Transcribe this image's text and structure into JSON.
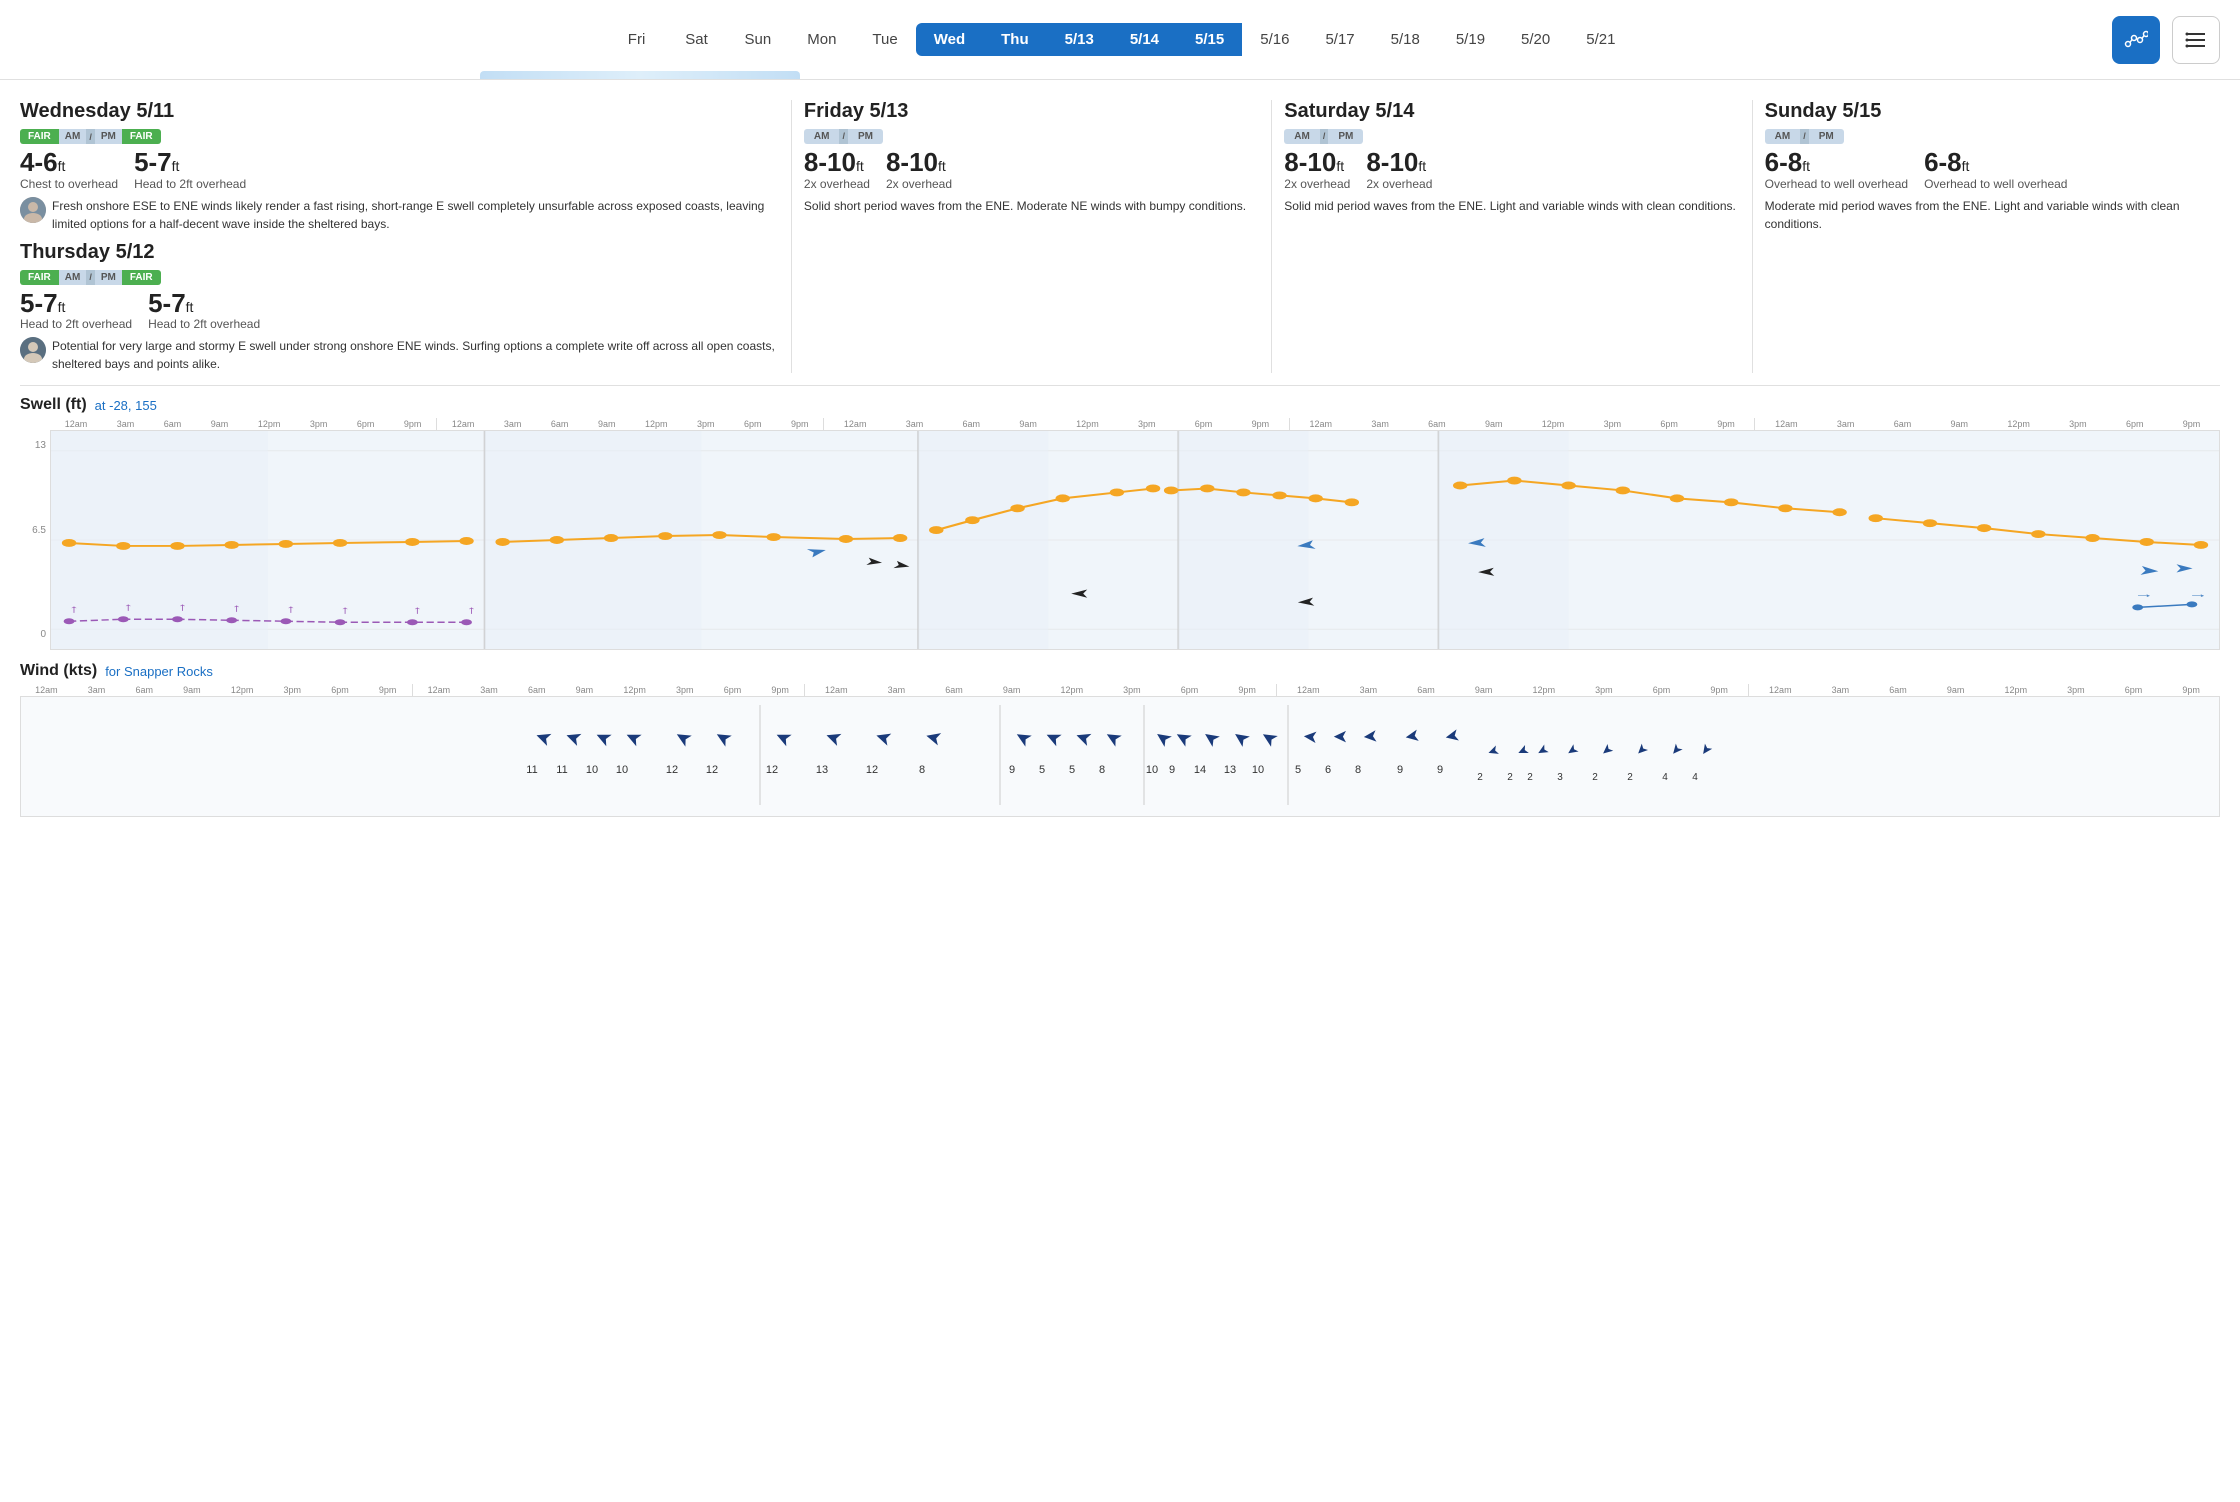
{
  "nav": {
    "days": [
      {
        "label": "Fri",
        "state": "normal"
      },
      {
        "label": "Sat",
        "state": "normal"
      },
      {
        "label": "Sun",
        "state": "normal"
      },
      {
        "label": "Mon",
        "state": "normal"
      },
      {
        "label": "Tue",
        "state": "normal"
      },
      {
        "label": "Wed",
        "state": "selected-start"
      },
      {
        "label": "Thu",
        "state": "selected-mid"
      },
      {
        "label": "5/13",
        "state": "selected-mid"
      },
      {
        "label": "5/14",
        "state": "selected-mid"
      },
      {
        "label": "5/15",
        "state": "selected-end"
      },
      {
        "label": "5/16",
        "state": "normal"
      },
      {
        "label": "5/17",
        "state": "normal"
      },
      {
        "label": "5/18",
        "state": "normal"
      },
      {
        "label": "5/19",
        "state": "normal"
      },
      {
        "label": "5/20",
        "state": "normal"
      },
      {
        "label": "5/21",
        "state": "normal"
      }
    ],
    "graph_btn_label": "📈",
    "list_btn_label": "≡"
  },
  "colors": {
    "fair": "#4caf50",
    "blue": "#1a6fc4",
    "orange": "#f5a623",
    "wind_arrow": "#1a3a7a",
    "swell_orange": "#f5a623",
    "swell_purple": "#9b59b6",
    "swell_blue_arrow": "#3a7abf"
  },
  "sections": {
    "wed": {
      "title": "Wednesday 5/11",
      "am": {
        "rating": "FAIR",
        "height": "4-6",
        "unit": "ft",
        "desc": "Chest to overhead"
      },
      "pm": {
        "rating": "FAIR",
        "height": "5-7",
        "unit": "ft",
        "desc": "Head to 2ft overhead"
      },
      "forecast": "Fresh onshore ESE to ENE winds likely render a fast rising, short-range E swell completely unsurfable across exposed coasts, leaving limited options for a half-decent wave inside the sheltered bays."
    },
    "thu": {
      "title": "Thursday 5/12",
      "am": {
        "rating": "FAIR",
        "height": "5-7",
        "unit": "ft",
        "desc": "Head to 2ft overhead"
      },
      "pm": {
        "rating": "FAIR",
        "height": "5-7",
        "unit": "ft",
        "desc": "Head to 2ft overhead"
      },
      "forecast": "Potential for very large and stormy E swell under strong onshore ENE winds. Surfing options a complete write off across all open coasts, sheltered bays and points alike."
    },
    "fri": {
      "title": "Friday 5/13",
      "am": {
        "rating": "",
        "height": "8-10",
        "unit": "ft",
        "desc": "2x overhead"
      },
      "pm": {
        "rating": "",
        "height": "8-10",
        "unit": "ft",
        "desc": "2x overhead"
      },
      "forecast": "Solid short period waves from the ENE. Moderate NE winds with bumpy conditions."
    },
    "sat": {
      "title": "Saturday 5/14",
      "am": {
        "rating": "",
        "height": "8-10",
        "unit": "ft",
        "desc": "2x overhead"
      },
      "pm": {
        "rating": "",
        "height": "8-10",
        "unit": "ft",
        "desc": "2x overhead"
      },
      "forecast": "Solid mid period waves from the ENE. Light and variable winds with clean conditions."
    },
    "sun": {
      "title": "Sunday 5/15",
      "am": {
        "rating": "",
        "height": "6-8",
        "unit": "ft",
        "desc": "Overhead to well overhead"
      },
      "pm": {
        "rating": "",
        "height": "6-8",
        "unit": "ft",
        "desc": "Overhead to well overhead"
      },
      "forecast": "Moderate mid period waves from the ENE. Light and variable winds with clean conditions."
    }
  },
  "swell": {
    "title": "Swell (ft)",
    "coords": "at -28, 155",
    "y_high": "13",
    "y_mid": "6.5",
    "y_low": "0",
    "time_labels": [
      "12am",
      "3am",
      "6am",
      "9am",
      "12pm",
      "3pm",
      "6pm",
      "9pm"
    ]
  },
  "wind": {
    "title": "Wind (kts)",
    "location": "for Snapper Rocks",
    "time_labels": [
      "12am",
      "3am",
      "6am",
      "9am",
      "12pm",
      "3pm",
      "6pm",
      "9pm"
    ],
    "wed_values": [
      "11",
      "11",
      "10",
      "10",
      "12",
      "12"
    ],
    "thu_values": [
      "12",
      "13",
      "12",
      "8"
    ],
    "fri_values": [
      "9",
      "5",
      "5",
      "8",
      "10",
      "9",
      "14",
      "13",
      "10"
    ],
    "sat_values": [
      "5",
      "6",
      "8",
      "9",
      "9"
    ],
    "sun_values": [
      "2",
      "2",
      "2",
      "3",
      "2",
      "2",
      "4"
    ]
  }
}
